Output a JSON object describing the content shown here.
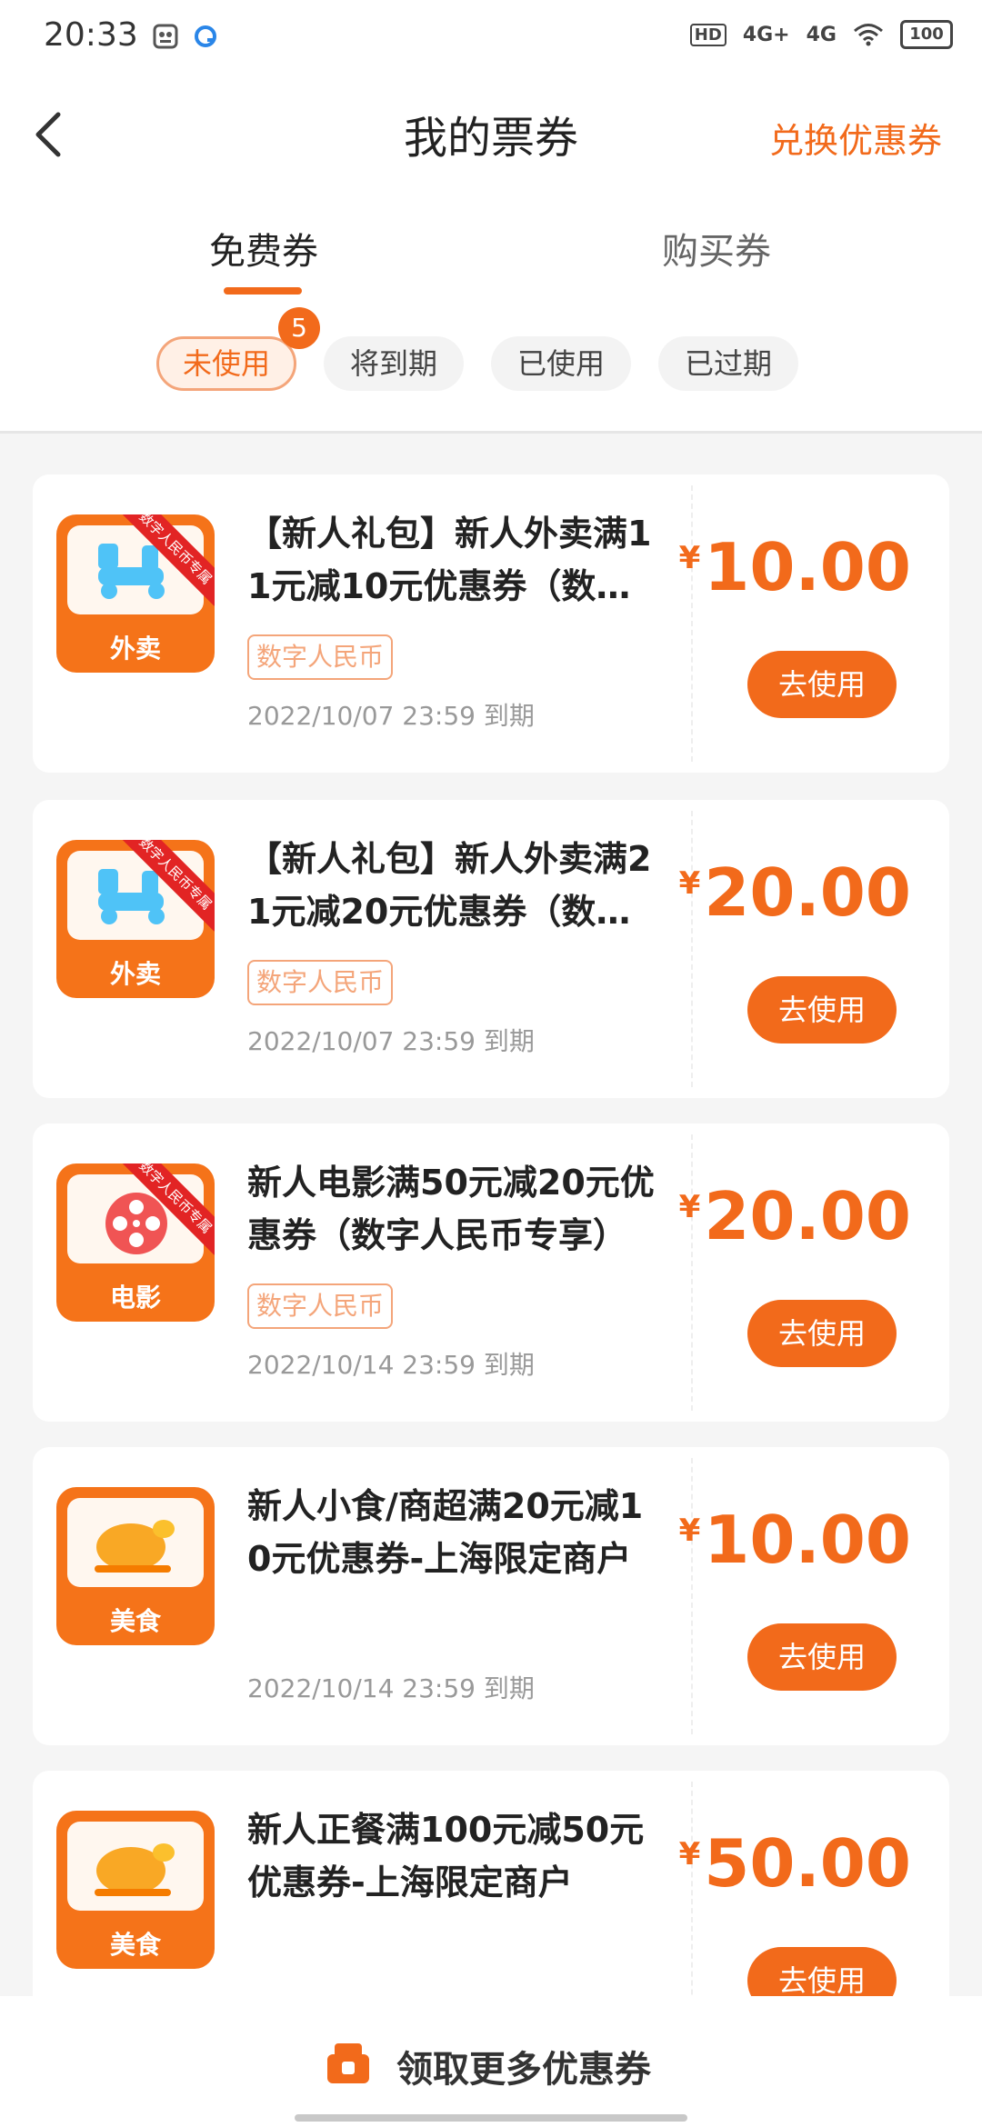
{
  "status_bar": {
    "time": "20:33",
    "signal_1": "4G+",
    "signal_2": "4G",
    "battery": "100",
    "hd": "HD"
  },
  "header": {
    "title": "我的票券",
    "action": "兑换优惠券"
  },
  "tabs": [
    {
      "label": "免费券",
      "active": true
    },
    {
      "label": "购买券",
      "active": false
    }
  ],
  "filters": [
    {
      "label": "未使用",
      "active": true,
      "badge": "5"
    },
    {
      "label": "将到期",
      "active": false
    },
    {
      "label": "已使用",
      "active": false
    },
    {
      "label": "已过期",
      "active": false
    }
  ],
  "coupons": [
    {
      "category": "外卖",
      "category_icon": "scooter-icon",
      "ribbon": "数字人民币专属",
      "title": "【新人礼包】新人外卖满11元减10元优惠券（数…",
      "tag": "数字人民币",
      "expiry": "2022/10/07 23:59 到期",
      "amount": "10.00",
      "button": "去使用"
    },
    {
      "category": "外卖",
      "category_icon": "scooter-icon",
      "ribbon": "数字人民币专属",
      "title": "【新人礼包】新人外卖满21元减20元优惠券（数…",
      "tag": "数字人民币",
      "expiry": "2022/10/07 23:59 到期",
      "amount": "20.00",
      "button": "去使用"
    },
    {
      "category": "电影",
      "category_icon": "film-reel-icon",
      "ribbon": "数字人民币专属",
      "title": "新人电影满50元减20元优惠券（数字人民币专享）",
      "tag": "数字人民币",
      "expiry": "2022/10/14 23:59 到期",
      "amount": "20.00",
      "button": "去使用"
    },
    {
      "category": "美食",
      "category_icon": "roast-chicken-icon",
      "title": "新人小食/商超满20元减10元优惠券-上海限定商户",
      "expiry": "2022/10/14 23:59 到期",
      "amount": "10.00",
      "button": "去使用"
    },
    {
      "category": "美食",
      "category_icon": "roast-chicken-icon",
      "title": "新人正餐满100元减50元优惠券-上海限定商户",
      "amount": "50.00",
      "button": "去使用"
    }
  ],
  "currency_symbol": "¥",
  "bottom": {
    "label": "领取更多优惠券"
  },
  "colors": {
    "accent": "#f26a1b",
    "ribbon": "#e22424",
    "background": "#f5f5f5"
  }
}
